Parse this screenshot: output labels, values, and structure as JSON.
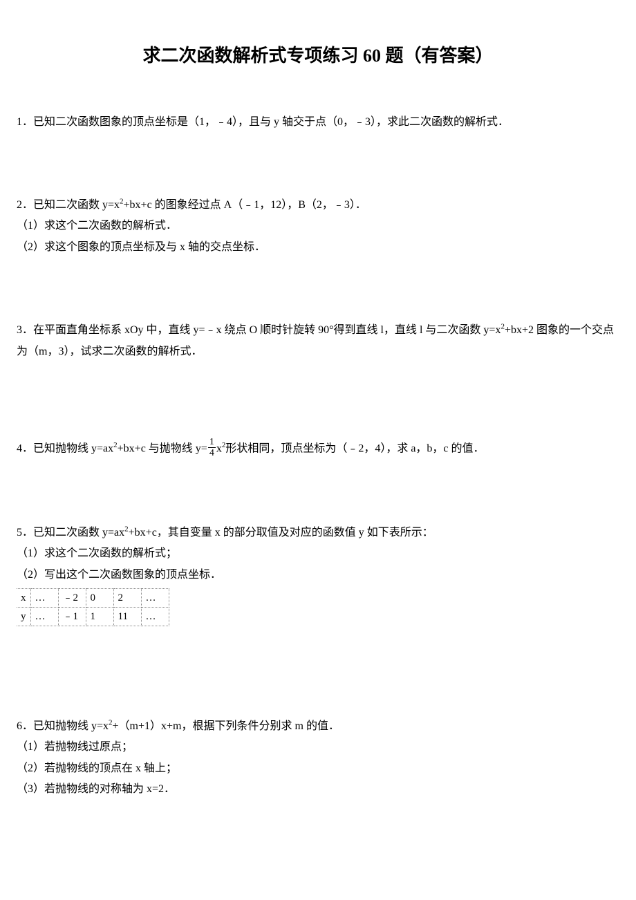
{
  "title": "求二次函数解析式专项练习 60 题（有答案）",
  "problems": {
    "p1": {
      "text": "1．已知二次函数图象的顶点坐标是（1，﹣4），且与 y 轴交于点（0，﹣3），求此二次函数的解析式．"
    },
    "p2": {
      "line1_pre": "2．已知二次函数 y=x",
      "line1_post": "+bx+c 的图象经过点 A（﹣1，12），B（2，﹣3）．",
      "line2": "（1）求这个二次函数的解析式．",
      "line3": "（2）求这个图象的顶点坐标及与 x 轴的交点坐标．"
    },
    "p3": {
      "pre": "3．在平面直角坐标系 xOy 中，直线 y=﹣x 绕点 O 顺时针旋转 90°得到直线 l，直线 l 与二次函数 y=x",
      "post": "+bx+2 图象的一个交点为（m，3），试求二次函数的解析式．"
    },
    "p4": {
      "pre": "4．已知抛物线 y=ax",
      "mid1": "+bx+c 与抛物线 ",
      "frac_before": "y=",
      "frac_num": "1",
      "frac_den": "4",
      "frac_after": "x",
      "post": "形状相同，顶点坐标为（﹣2，4），求 a，b，c 的值．"
    },
    "p5": {
      "line1_pre": "5．已知二次函数 y=ax",
      "line1_post": "+bx+c，其自变量 x 的部分取值及对应的函数值 y 如下表所示：",
      "line2": "（1）求这个二次函数的解析式；",
      "line3": "（2）写出这个二次函数图象的顶点坐标．",
      "table": {
        "r1": [
          "x",
          "…",
          "﹣2",
          "0",
          "2",
          "…"
        ],
        "r2": [
          "y",
          "…",
          "﹣1",
          "1",
          "11",
          "…"
        ]
      }
    },
    "p6": {
      "line1_pre": "6．已知抛物线 y=x",
      "line1_post": "+（m+1）x+m，根据下列条件分别求 m 的值．",
      "line2": "（1）若抛物线过原点；",
      "line3": "（2）若抛物线的顶点在 x 轴上；",
      "line4": "（3）若抛物线的对称轴为 x=2．"
    }
  }
}
